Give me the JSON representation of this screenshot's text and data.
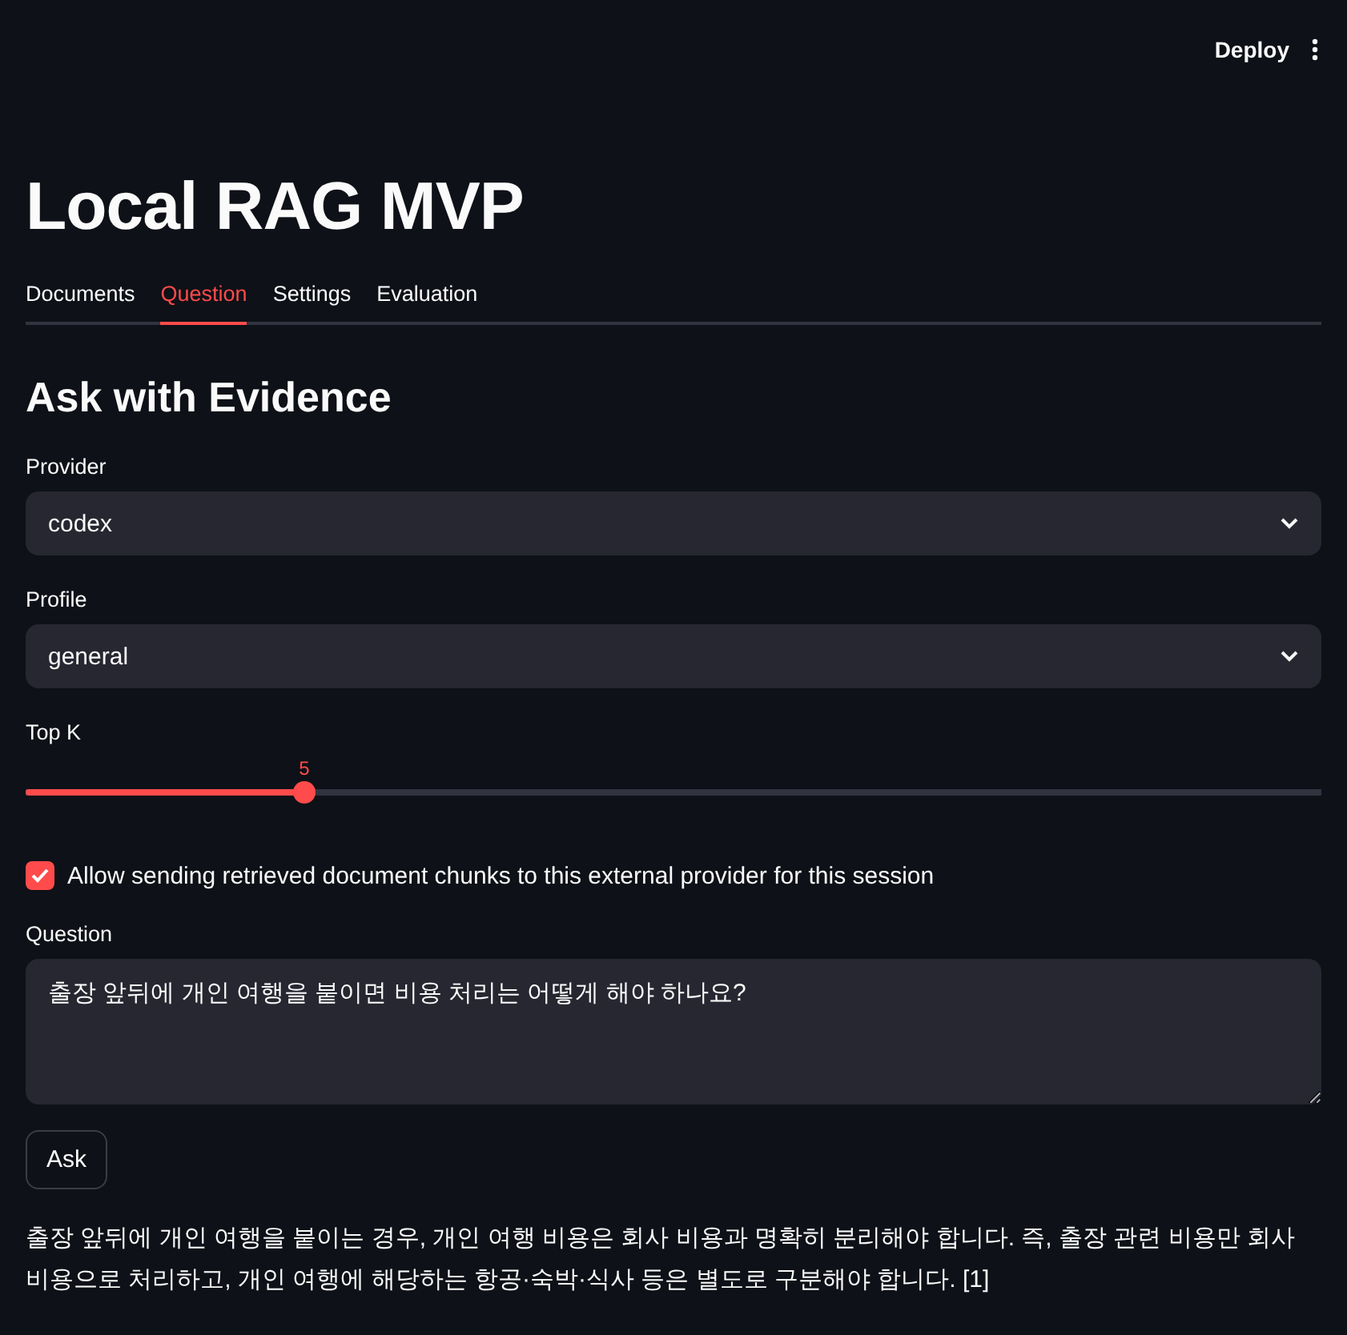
{
  "header": {
    "deploy": "Deploy"
  },
  "title": "Local RAG MVP",
  "tabs": [
    {
      "label": "Documents",
      "selected": false
    },
    {
      "label": "Question",
      "selected": true
    },
    {
      "label": "Settings",
      "selected": false
    },
    {
      "label": "Evaluation",
      "selected": false
    }
  ],
  "section_title": "Ask with Evidence",
  "selects": [
    {
      "label": "Provider",
      "value": "codex"
    },
    {
      "label": "Profile",
      "value": "general"
    }
  ],
  "slider": {
    "label": "Top K",
    "reading": "5",
    "level": 0.215
  },
  "consent": {
    "label": "Allow sending retrieved document chunks to this external provider for this session",
    "checked": true
  },
  "question": {
    "label": "Question",
    "value": "출장 앞뒤에 개인 여행을 붙이면 비용 처리는 어떻게 해야 하나요?"
  },
  "ask_button": "Ask",
  "answer": "출장 앞뒤에 개인 여행을 붙이는 경우, 개인 여행 비용은 회사 비용과 명확히 분리해야 합니다. 즉, 출장 관련 비용만 회사 비용으로 처리하고, 개인 여행에 해당하는 항공·숙박·식사 등은 별도로 구분해야 합니다. [1]"
}
